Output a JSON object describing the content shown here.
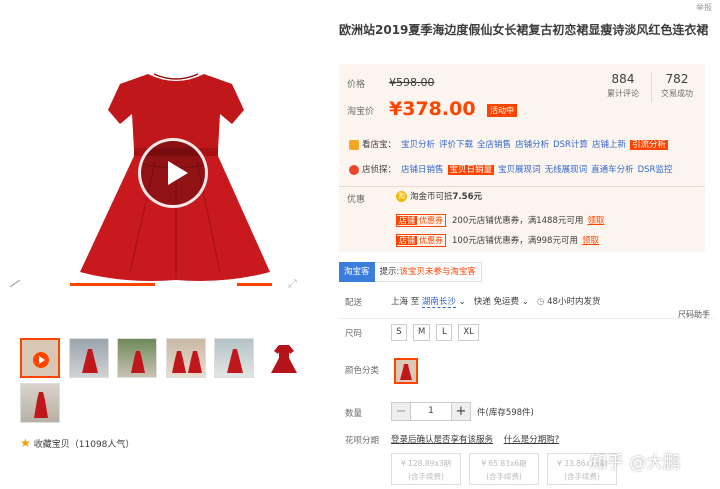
{
  "report_label": "举报",
  "title": "欧洲站2019夏季海边度假仙女长裙复古初恋裙显瘦诗淡风红色连衣裙",
  "price": {
    "orig_label": "价格",
    "orig_value": "¥598.00",
    "sale_label": "淘宝价",
    "sale_value": "¥378.00",
    "sale_tag": "活动中",
    "accent_color": "#ff4400"
  },
  "stats": [
    {
      "num": "884",
      "caption": "累计评论"
    },
    {
      "num": "782",
      "caption": "交易成功"
    }
  ],
  "tools": [
    {
      "head": "看店宝：",
      "links": [
        "宝贝分析",
        "评价下载",
        "全店销售",
        "店铺分析",
        "DSR计算",
        "店铺上新"
      ],
      "highlight": "引流分析"
    },
    {
      "head": "店侦探：",
      "links": [
        "店铺日销售"
      ],
      "highlight": "宝贝日销量",
      "links2": [
        "宝贝展现词",
        "无线展现词",
        "直通车分析",
        "DSR监控"
      ]
    }
  ],
  "promo": {
    "label": "优惠",
    "coin_text": "淘金币可抵",
    "coin_value": "7.56元",
    "coupons": [
      {
        "tag_a": "店铺",
        "tag_b": "优惠券",
        "text": "200元店铺优惠券，满1488元可用",
        "action": "领取"
      },
      {
        "tag_a": "店铺",
        "tag_b": "优惠券",
        "text": "100元店铺优惠券，满998元可用",
        "action": "领取"
      }
    ]
  },
  "taobaobao": {
    "tag": "淘宝客",
    "tip_prefix": "提示:",
    "tip_warning": "该宝贝未参与淘宝客"
  },
  "shipping": {
    "label": "配送",
    "route": "上海 至",
    "dest": "湖南长沙",
    "fee": "快递 免运费",
    "time": "48小时内发货"
  },
  "size_helper": "尺码助手",
  "size": {
    "label": "尺码",
    "options": [
      "S",
      "M",
      "L",
      "XL"
    ]
  },
  "color": {
    "label": "颜色分类"
  },
  "quantity": {
    "label": "数量",
    "value": "1",
    "stock": "件(库存598件)"
  },
  "installment": {
    "label": "花呗分期",
    "link1": "登录后确认是否享有该服务",
    "link2": "什么是分期购?",
    "plans": [
      {
        "line1": "¥ 128.89x3期",
        "line2": "(含手续费)"
      },
      {
        "line1": "¥ 65.83x6期",
        "line2": "(含手续费)"
      },
      {
        "line1": "¥ 33.86x12期",
        "line2": "(含手续费)"
      }
    ]
  },
  "collect": {
    "label": "收藏宝贝",
    "count": "（11098人气）"
  },
  "watermark": "知乎 @大鹏"
}
